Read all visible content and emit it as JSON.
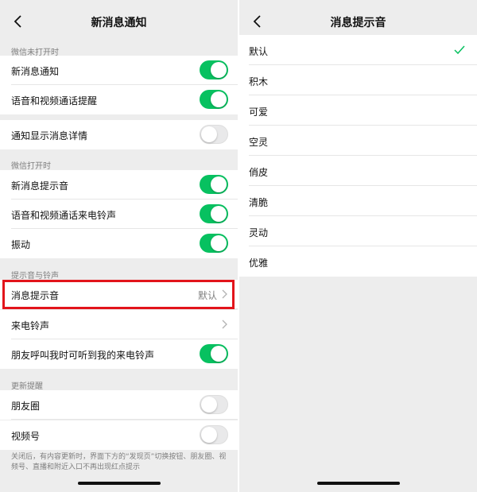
{
  "colors": {
    "accent": "#07c160",
    "highlight": "#e2141b"
  },
  "left": {
    "title": "新消息通知",
    "back_icon": "chevron-left-icon",
    "section1": {
      "header": "微信未打开时",
      "rows": [
        {
          "label": "新消息通知",
          "toggle": "on"
        },
        {
          "label": "语音和视频通话提醒",
          "toggle": "on"
        }
      ]
    },
    "section_detail": {
      "label": "通知显示消息详情",
      "toggle": "off"
    },
    "section2": {
      "header": "微信打开时",
      "rows": [
        {
          "label": "新消息提示音",
          "toggle": "on"
        },
        {
          "label": "语音和视频通话来电铃声",
          "toggle": "on"
        },
        {
          "label": "振动",
          "toggle": "on"
        }
      ]
    },
    "section3": {
      "header": "提示音与铃声",
      "message_tone": {
        "label": "消息提示音",
        "value": "默认"
      },
      "ringtone": {
        "label": "来电铃声"
      },
      "friend_ring": {
        "label": "朋友呼叫我时可听到我的来电铃声",
        "toggle": "on"
      }
    },
    "section4": {
      "header": "更新提醒",
      "rows": [
        {
          "label": "朋友圈",
          "toggle": "off"
        },
        {
          "label": "视频号",
          "toggle": "off"
        }
      ]
    },
    "footnote": "关闭后，有内容更新时，界面下方的“发现页”切换按钮、朋友圈、视频号、直播和附近入口不再出现红点提示"
  },
  "right": {
    "title": "消息提示音",
    "back_icon": "chevron-left-icon",
    "selected": "默认",
    "options": [
      "默认",
      "积木",
      "可爱",
      "空灵",
      "俏皮",
      "清脆",
      "灵动",
      "优雅"
    ]
  }
}
